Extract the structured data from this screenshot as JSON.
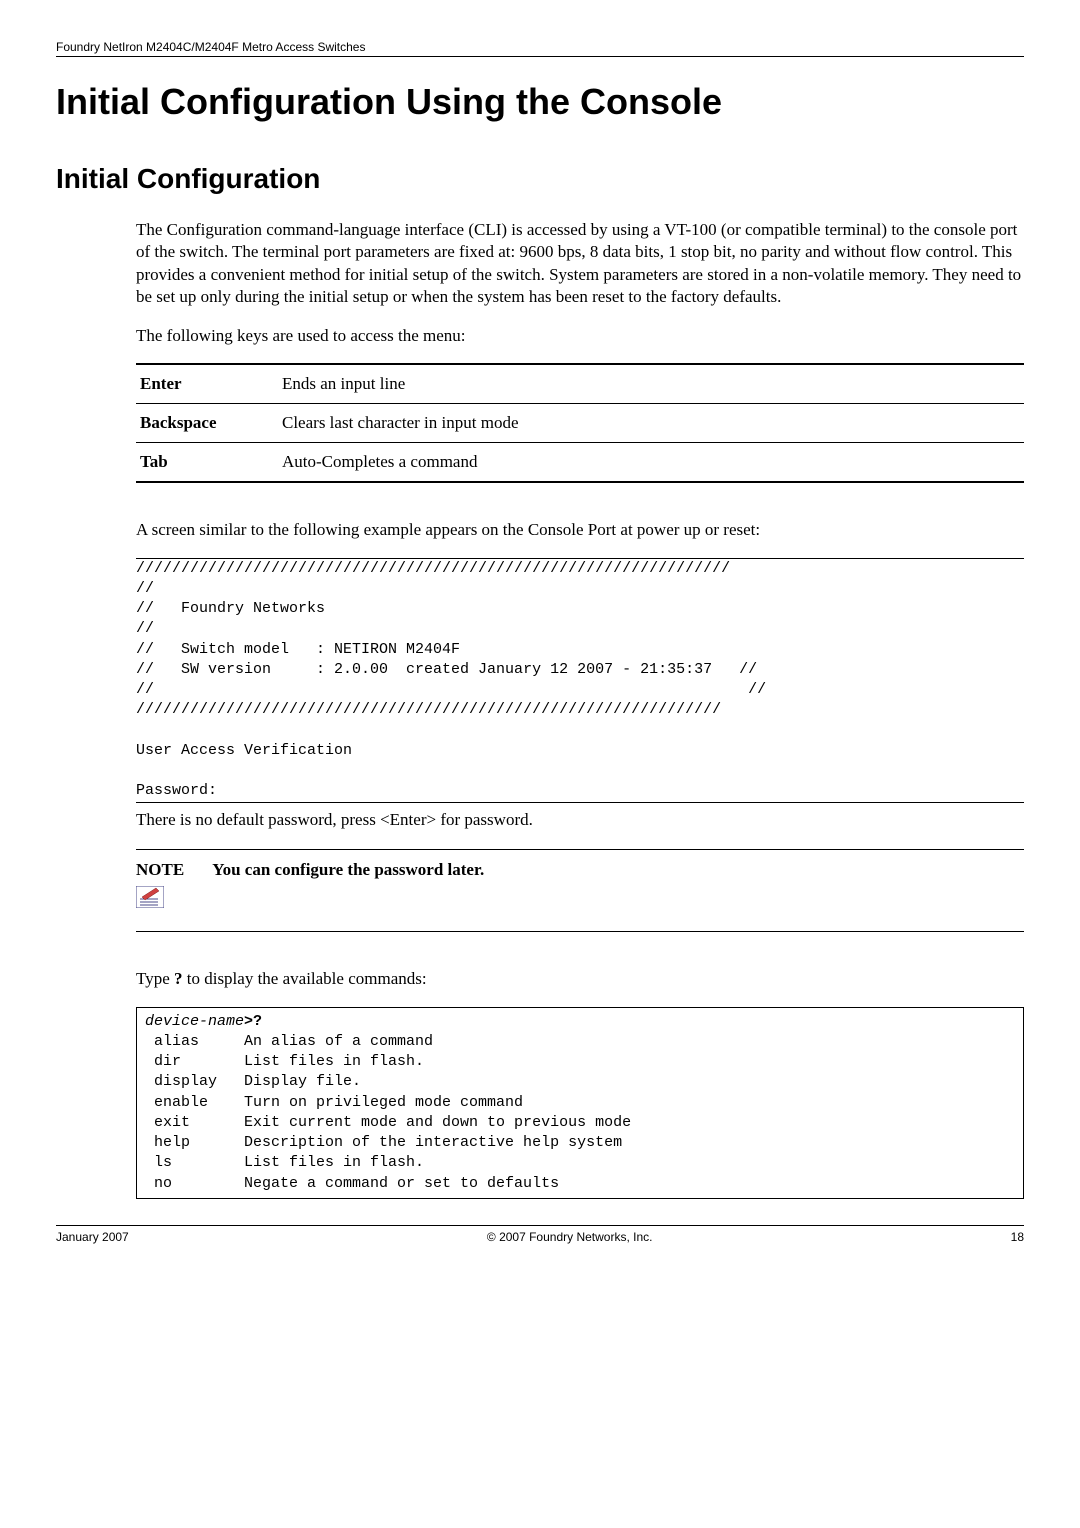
{
  "header": {
    "product_line": "Foundry NetIron M2404C/M2404F Metro Access Switches"
  },
  "h1": "Initial Configuration Using the Console",
  "h2": "Initial Configuration",
  "intro_p1": "The Configuration command-language interface (CLI) is accessed by using a VT-100 (or compatible terminal) to the console port of the switch. The terminal port parameters are fixed at: 9600 bps, 8 data bits, 1 stop bit, no parity and without flow control. This provides a convenient method for initial setup of the switch. System parameters are stored in a non-volatile memory. They need to be set up only during the initial setup or when the system has been reset to the factory defaults.",
  "intro_p2": "The following keys are used to access the menu:",
  "keys": [
    {
      "name": "Enter",
      "desc": "Ends an input line"
    },
    {
      "name": "Backspace",
      "desc": "Clears last character in input mode"
    },
    {
      "name": "Tab",
      "desc": "Auto-Completes a command"
    }
  ],
  "console_intro": "A screen similar to the following example appears on the Console Port at power up or reset:",
  "console_block": "//////////////////////////////////////////////////////////////////\n//\n//   Foundry Networks\n//\n//   Switch model   : NETIRON M2404F\n//   SW version     : 2.0.00  created January 12 2007 - 21:35:37   //\n//                                                                  //\n/////////////////////////////////////////////////////////////////\n\nUser Access Verification\n\nPassword:",
  "after_console": "There is no default password, press <Enter> for password.",
  "note": {
    "label": "NOTE",
    "text": "You can configure the password later."
  },
  "type_q_intro_pre": "Type ",
  "type_q_char": "?",
  "type_q_intro_post": " to display the available commands:",
  "cmd_block_prefix": "device-name",
  "cmd_block_prompt": ">?",
  "cmd_block_body": " alias     An alias of a command\n dir       List files in flash.\n display   Display file.\n enable    Turn on privileged mode command\n exit      Exit current mode and down to previous mode\n help      Description of the interactive help system\n ls        List files in flash.\n no        Negate a command or set to defaults",
  "footer": {
    "left": "January 2007",
    "center": "© 2007 Foundry Networks, Inc.",
    "right": "18"
  }
}
